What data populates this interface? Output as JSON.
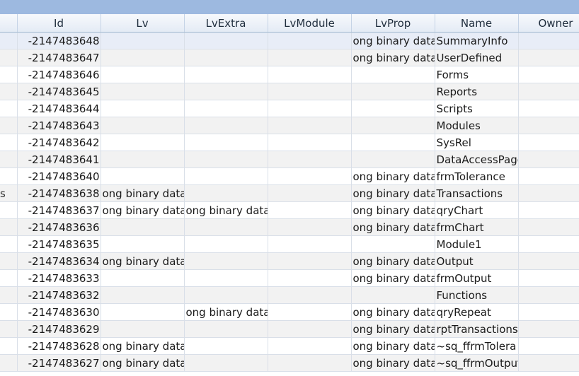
{
  "columns": [
    "",
    "Id",
    "Lv",
    "LvExtra",
    "LvModule",
    "LvProp",
    "Name",
    "Owner"
  ],
  "rows": [
    {
      "edge": "",
      "id": "-2147483648",
      "lv": "",
      "lvextra": "",
      "lvmodule": "",
      "lvprop": "ong binary data",
      "name": "SummaryInfo",
      "owner": ""
    },
    {
      "edge": "",
      "id": "-2147483647",
      "lv": "",
      "lvextra": "",
      "lvmodule": "",
      "lvprop": "ong binary data",
      "name": "UserDefined",
      "owner": ""
    },
    {
      "edge": "",
      "id": "-2147483646",
      "lv": "",
      "lvextra": "",
      "lvmodule": "",
      "lvprop": "",
      "name": "Forms",
      "owner": ""
    },
    {
      "edge": "",
      "id": "-2147483645",
      "lv": "",
      "lvextra": "",
      "lvmodule": "",
      "lvprop": "",
      "name": "Reports",
      "owner": ""
    },
    {
      "edge": "",
      "id": "-2147483644",
      "lv": "",
      "lvextra": "",
      "lvmodule": "",
      "lvprop": "",
      "name": "Scripts",
      "owner": ""
    },
    {
      "edge": "",
      "id": "-2147483643",
      "lv": "",
      "lvextra": "",
      "lvmodule": "",
      "lvprop": "",
      "name": "Modules",
      "owner": ""
    },
    {
      "edge": "",
      "id": "-2147483642",
      "lv": "",
      "lvextra": "",
      "lvmodule": "",
      "lvprop": "",
      "name": "SysRel",
      "owner": ""
    },
    {
      "edge": "",
      "id": "-2147483641",
      "lv": "",
      "lvextra": "",
      "lvmodule": "",
      "lvprop": "",
      "name": "DataAccessPage",
      "owner": ""
    },
    {
      "edge": "",
      "id": "-2147483640",
      "lv": "",
      "lvextra": "",
      "lvmodule": "",
      "lvprop": "ong binary data",
      "name": "frmTolerance",
      "owner": ""
    },
    {
      "edge": "s",
      "id": "-2147483638",
      "lv": "ong binary data",
      "lvextra": "",
      "lvmodule": "",
      "lvprop": "ong binary data",
      "name": "Transactions",
      "owner": ""
    },
    {
      "edge": "",
      "id": "-2147483637",
      "lv": "ong binary data",
      "lvextra": "ong binary data",
      "lvmodule": "",
      "lvprop": "ong binary data",
      "name": "qryChart",
      "owner": ""
    },
    {
      "edge": "",
      "id": "-2147483636",
      "lv": "",
      "lvextra": "",
      "lvmodule": "",
      "lvprop": "ong binary data",
      "name": "frmChart",
      "owner": ""
    },
    {
      "edge": "",
      "id": "-2147483635",
      "lv": "",
      "lvextra": "",
      "lvmodule": "",
      "lvprop": "",
      "name": "Module1",
      "owner": ""
    },
    {
      "edge": "",
      "id": "-2147483634",
      "lv": "ong binary data",
      "lvextra": "",
      "lvmodule": "",
      "lvprop": "ong binary data",
      "name": "Output",
      "owner": ""
    },
    {
      "edge": "",
      "id": "-2147483633",
      "lv": "",
      "lvextra": "",
      "lvmodule": "",
      "lvprop": "ong binary data",
      "name": "frmOutput",
      "owner": ""
    },
    {
      "edge": "",
      "id": "-2147483632",
      "lv": "",
      "lvextra": "",
      "lvmodule": "",
      "lvprop": "",
      "name": "Functions",
      "owner": ""
    },
    {
      "edge": "",
      "id": "-2147483630",
      "lv": "",
      "lvextra": "ong binary data",
      "lvmodule": "",
      "lvprop": "ong binary data",
      "name": "qryRepeat",
      "owner": ""
    },
    {
      "edge": "",
      "id": "-2147483629",
      "lv": "",
      "lvextra": "",
      "lvmodule": "",
      "lvprop": "ong binary data",
      "name": "rptTransactions",
      "owner": ""
    },
    {
      "edge": "",
      "id": "-2147483628",
      "lv": "ong binary data",
      "lvextra": "",
      "lvmodule": "",
      "lvprop": "ong binary data",
      "name": "~sq_ffrmTolera",
      "owner": ""
    },
    {
      "edge": "",
      "id": "-2147483627",
      "lv": "ong binary data",
      "lvextra": "",
      "lvmodule": "",
      "lvprop": "ong binary data",
      "name": "~sq_ffrmOutput",
      "owner": ""
    }
  ]
}
